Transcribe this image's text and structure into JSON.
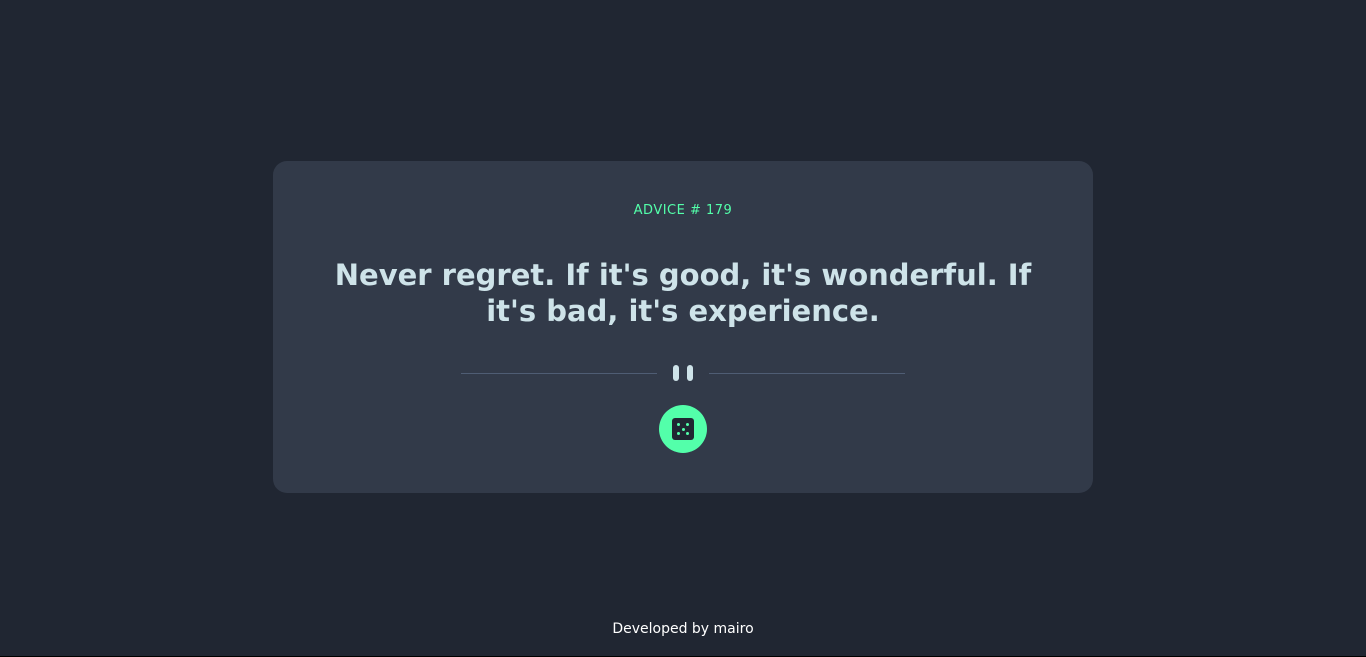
{
  "card": {
    "advice_id": "ADVICE # 179",
    "advice_text": "Never regret. If it's good, it's wonderful. If it's bad, it's experience."
  },
  "divider": {
    "icon": "pause-icon"
  },
  "button": {
    "icon": "dice-icon"
  },
  "footer": {
    "text": "Developed by mairo"
  },
  "colors": {
    "background": "#202632",
    "card": "#323a49",
    "accent": "#53ffaa",
    "text": "#cee3e9",
    "divider": "#4f5d74"
  }
}
